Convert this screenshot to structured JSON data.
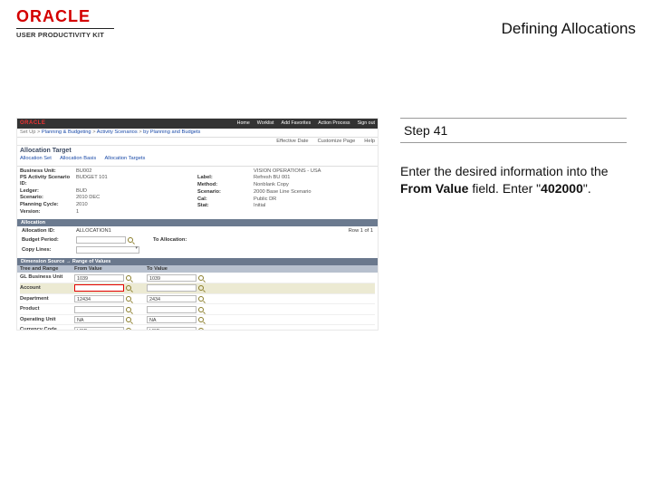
{
  "header": {
    "logo": "ORACLE",
    "logo_sub": "USER PRODUCTIVITY KIT",
    "title": "Defining Allocations"
  },
  "step": {
    "label": "Step 41",
    "text_a": "Enter the desired information into the ",
    "text_b": "From Value",
    "text_c": " field. Enter \"",
    "text_d": "402000",
    "text_e": "\"."
  },
  "shot": {
    "brand": "ORACLE",
    "topmenu": [
      "Home",
      "Worklist",
      "Add Favorites",
      "Action Process",
      "Sign out"
    ],
    "crumbs_a": "Set Up >",
    "crumbs_links": [
      "Planning & Budgeting",
      "Activity Scenarios",
      "by Planning and Budgets"
    ],
    "toolbar": [
      "Effective Date",
      "Customize Page",
      "Help"
    ],
    "page_title": "Allocation Target",
    "sublinks": [
      "Allocation Set",
      "Allocation Basis",
      "Allocation Targets"
    ],
    "left": {
      "Business Unit:": "BU002",
      "PS Activity Scenario ID:": "BUDGET 101",
      "Ledger:": "BUD",
      "Scenario:": "2010 DEC",
      "Planning Cycle:": "2010",
      "Version:": "1"
    },
    "right": {
      "": "VISION OPERATIONS - USA",
      "Label:": "Refresh BU 001",
      "Method:": "Nonblank Copy",
      "Scenario:": "2000 Base Line Scenario",
      "Cal:": "Public DR",
      "Stat:": "Initial"
    },
    "sect1": "Allocation",
    "form": {
      "Allocation ID:": "ALLOCATION1",
      "Budget Period:": "",
      "Copy Lines:": "",
      "right_label": "To Allocation:",
      "right_count": "Row 1 of 1"
    },
    "sect2": "Dimension Source → Range of Values",
    "grid": {
      "head": [
        "Tree and Range",
        "From Value",
        "To Value"
      ],
      "rows": [
        {
          "name": "GL Business Unit",
          "from": "1039",
          "to": "1039"
        },
        {
          "name": "Account",
          "from": "",
          "to": "",
          "hl": true,
          "sel": true
        },
        {
          "name": "Department",
          "from": "12434",
          "to": "2434"
        },
        {
          "name": "Product",
          "from": "",
          "to": ""
        },
        {
          "name": "Operating Unit",
          "from": "NA",
          "to": "NA"
        },
        {
          "name": "Currency Code",
          "from": "USD",
          "to": "USD"
        }
      ]
    }
  }
}
